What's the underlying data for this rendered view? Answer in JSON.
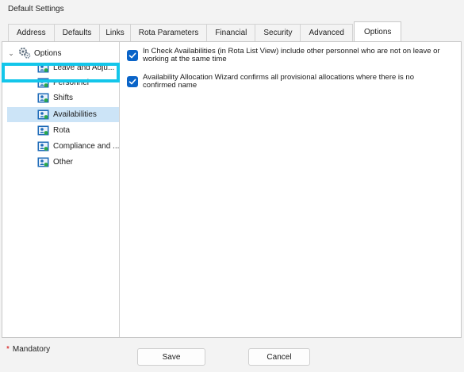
{
  "window": {
    "title": "Default Settings"
  },
  "tabs": [
    {
      "label": "Address"
    },
    {
      "label": "Defaults"
    },
    {
      "label": "Links"
    },
    {
      "label": "Rota Parameters"
    },
    {
      "label": "Financial"
    },
    {
      "label": "Security"
    },
    {
      "label": "Advanced"
    },
    {
      "label": "Options",
      "active": true
    }
  ],
  "tree": {
    "root": {
      "label": "Options",
      "icon": "gears-icon",
      "expanded": true
    },
    "items": [
      {
        "label": "Leave and Adju...",
        "icon": "user-card-icon"
      },
      {
        "label": "Personnel",
        "icon": "user-card-icon"
      },
      {
        "label": "Shifts",
        "icon": "user-card-icon"
      },
      {
        "label": "Availabilities",
        "icon": "user-card-icon",
        "selected": true
      },
      {
        "label": "Rota",
        "icon": "user-card-icon"
      },
      {
        "label": "Compliance and ...",
        "icon": "user-card-icon"
      },
      {
        "label": "Other",
        "icon": "user-card-icon"
      }
    ]
  },
  "options": [
    {
      "text": "In Check Availabilities (in Rota List View) include other personnel who are not on leave or working at the same time",
      "checked": true
    },
    {
      "text": "Availability Allocation Wizard confirms all provisional allocations where there is no confirmed name",
      "checked": true
    }
  ],
  "footer": {
    "mandatory_star": "*",
    "mandatory_label": "Mandatory",
    "save_label": "Save",
    "cancel_label": "Cancel"
  },
  "colors": {
    "accent": "#0a64c8",
    "selection": "#cce4f7",
    "highlight_border": "#13c6ea",
    "mandatory_star": "#d40000"
  }
}
